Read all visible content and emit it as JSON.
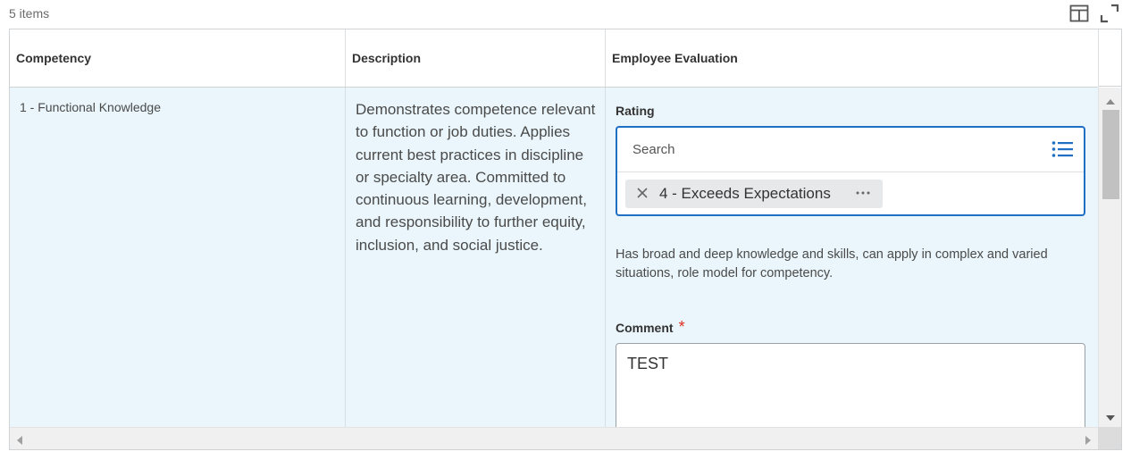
{
  "header": {
    "item_count": "5 items",
    "icons": [
      "table-layout-icon",
      "expand-icon"
    ]
  },
  "table": {
    "columns": [
      {
        "label": "Competency"
      },
      {
        "label": "Description"
      },
      {
        "label": "Employee Evaluation"
      }
    ],
    "rows": [
      {
        "competency": "1 - Functional Knowledge",
        "description": "Demonstrates competence relevant to function or job duties. Applies current best practices in discipline or specialty area. Committed to continuous learning, development, and responsibility to further equity, inclusion, and social justice.",
        "evaluation": {
          "rating_label": "Rating",
          "search_placeholder": "Search",
          "selected_rating": "4 - Exceeds Expectations",
          "rating_description": "Has broad and deep knowledge and skills, can apply in complex and varied situations, role model for competency.",
          "comment_label": "Comment",
          "comment_required_mark": "*",
          "comment_value": "TEST"
        }
      }
    ]
  },
  "colors": {
    "accent": "#1f6fc5",
    "row_highlight": "#eaf6fb",
    "required": "#de2e21"
  }
}
